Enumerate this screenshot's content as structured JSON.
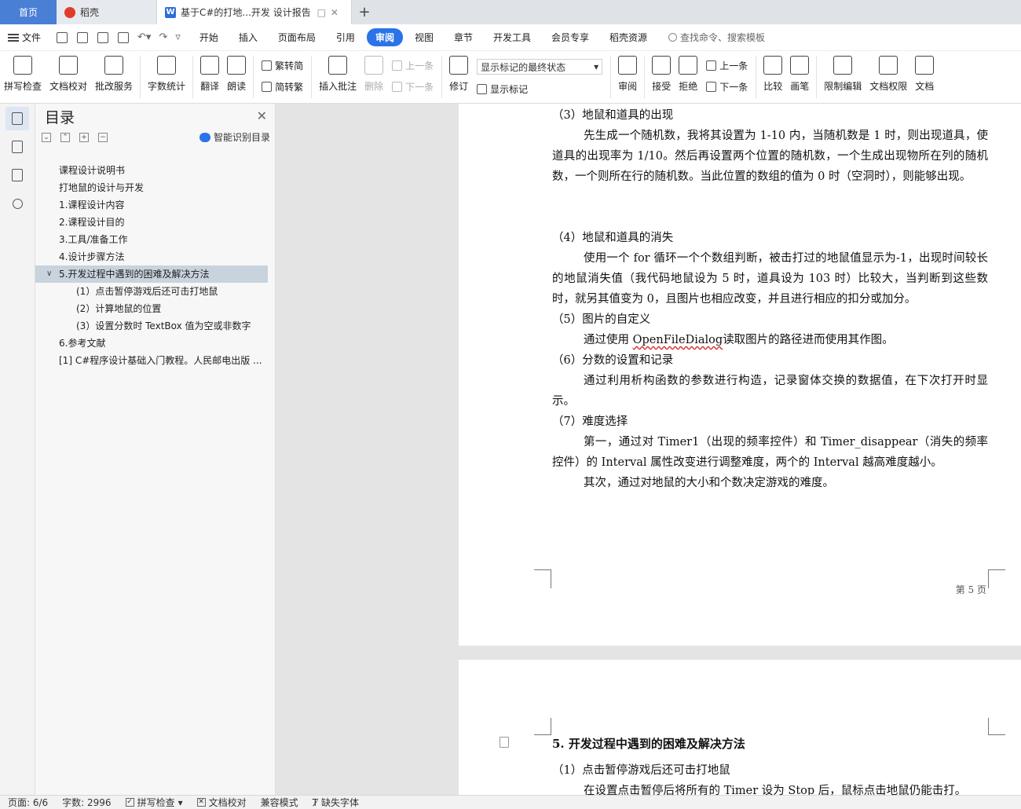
{
  "tabs": {
    "home": "首页",
    "app": "稻壳",
    "doc": "基于C#的打地...开发 设计报告",
    "doc_icon": "W"
  },
  "menu": {
    "file": "文件",
    "items": [
      "开始",
      "插入",
      "页面布局",
      "引用",
      "审阅",
      "视图",
      "章节",
      "开发工具",
      "会员专享",
      "稻壳资源"
    ],
    "active": "审阅",
    "search": "查找命令、搜索模板"
  },
  "ribbon": {
    "spell": "拼写检查",
    "proof": "文档校对",
    "review_service": "批改服务",
    "word_count": "字数统计",
    "translate": "翻译",
    "read_aloud": "朗读",
    "trad_to_simp": "繁转简",
    "simp_to_trad": "简转繁",
    "insert_comment": "插入批注",
    "delete": "删除",
    "prev_comment": "上一条",
    "next_comment": "下一条",
    "track": "修订",
    "markup_select": "显示标记的最终状态",
    "show_markup": "显示标记",
    "review": "审阅",
    "accept": "接受",
    "reject": "拒绝",
    "prev_change": "上一条",
    "next_change": "下一条",
    "compare": "比较",
    "pen": "画笔",
    "restrict_edit": "限制编辑",
    "doc_permission": "文档权限",
    "doc_more": "文档"
  },
  "toc": {
    "title": "目录",
    "ai_label": "智能识别目录",
    "items": [
      {
        "text": "课程设计说明书",
        "level": 1
      },
      {
        "text": "打地鼠的设计与开发",
        "level": 1
      },
      {
        "text": "1.课程设计内容",
        "level": 1
      },
      {
        "text": "2.课程设计目的",
        "level": 1
      },
      {
        "text": "3.工具/准备工作",
        "level": 1
      },
      {
        "text": "4.设计步骤方法",
        "level": 1
      },
      {
        "text": "5.开发过程中遇到的困难及解决方法",
        "level": 1,
        "selected": true
      },
      {
        "text": "(1）点击暂停游戏后还可击打地鼠",
        "level": 2
      },
      {
        "text": "(2）计算地鼠的位置",
        "level": 2
      },
      {
        "text": "(3）设置分数时 TextBox 值为空或非数字",
        "level": 2
      },
      {
        "text": "6.参考文献",
        "level": 1
      },
      {
        "text": "[1] C#程序设计基础入门教程。人民邮电出版 ...",
        "level": 1
      }
    ]
  },
  "page1": {
    "paragraphs": [
      {
        "text": "（3）地鼠和道具的出现",
        "kind": "head"
      },
      {
        "text": "先生成一个随机数，我将其设置为 1-10 内，当随机数是 1 时，则出现道具，使道具的出现率为 1/10。然后再设置两个位置的随机数，一个生成出现物所在列的随机数，一个则所在行的随机数。当此位置的数组的值为 0 时（空洞时），则能够出现。",
        "kind": "body"
      },
      {
        "text": "",
        "kind": "blank"
      },
      {
        "text": "",
        "kind": "blank"
      },
      {
        "text": "（4）地鼠和道具的消失",
        "kind": "head"
      },
      {
        "text": "使用一个 for 循环一个个数组判断，被击打过的地鼠值显示为-1，出现时间较长的地鼠消失值（我代码地鼠设为 5 时，道具设为 103 时）比较大，当判断到这些数时，就另其值变为 0，且图片也相应改变，并且进行相应的扣分或加分。",
        "kind": "body"
      },
      {
        "text": "（5）图片的自定义",
        "kind": "head"
      },
      {
        "text": "读取图片的路径进而使用其作图。",
        "kind": "body-link",
        "prefix": "通过使用 ",
        "link": "OpenFileDialog"
      },
      {
        "text": "（6）分数的设置和记录",
        "kind": "head"
      },
      {
        "text": "通过利用析构函数的参数进行构造，记录窗体交换的数据值，在下次打开时显示。",
        "kind": "body"
      },
      {
        "text": "（7）难度选择",
        "kind": "head"
      },
      {
        "text": "第一，通过对 Timer1（出现的频率控件）和 Timer_disappear（消失的频率控件）的 Interval 属性改变进行调整难度，两个的 Interval 越高难度越小。",
        "kind": "body"
      },
      {
        "text": "其次，通过对地鼠的大小和个数决定游戏的难度。",
        "kind": "body"
      }
    ],
    "page_number": "第 5 页"
  },
  "page2": {
    "heading": "5.   开发过程中遇到的困难及解决方法",
    "sub1": "（1）点击暂停游戏后还可击打地鼠",
    "line": "在设置点击暂停后将所有的 Timer 设为 Stop 后，鼠标点击地鼠仍能击打。"
  },
  "status": {
    "page": "页面: 6/6",
    "words": "字数: 2996",
    "spell": "拼写检查",
    "proof": "文档校对",
    "compat": "兼容模式",
    "missing_font": "缺失字体"
  }
}
